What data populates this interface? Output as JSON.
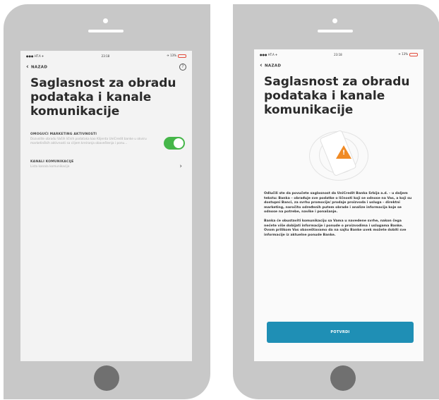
{
  "status_bar": {
    "carrier": "●●● HT.A ✈",
    "time": "23:18",
    "battery": "✈ 13%"
  },
  "left_screen": {
    "back_label": "NAZAD",
    "help_glyph": "?",
    "title": "Saglasnost za obradu podataka i kanale komunikacije",
    "marketing": {
      "title": "OMOGUĆI MARKETING AKTIVNOSTI",
      "description": "Dozvolite obradu Vaših ličnih podataka kao Klijenta UniCredit banke u okviru marketinških aktivnosti sa ciljem kreiranja obaveštenja i ponu...",
      "enabled": true
    },
    "channels": {
      "title": "KANALI KOMUNIKACIJE",
      "description": "Lista kanala komunikacije"
    }
  },
  "right_screen": {
    "back_label": "NAZAD",
    "title": "Saglasnost za obradu podataka i kanale komunikacije",
    "paragraph_1": "Odlučili ste da povučete saglasnost da UniCredit Banka Srbija a.d. – u daljem tekstu: Banka – obrađuje sve podatke o ličnosti koji se odnose na Vas, a koji su dostupni Banci, za svrhu promocije/ prodaje proizvoda i usluga – direktni marketing, naročito određenih putem obrade i analize informacija koje se odnose na potrebe, navike i ponašanje.",
    "paragraph_2": "Banka će obustaviti komunikaciju sa Vama u navedene svrhe, nakon čega nećete više dobijati informacije i ponude o proizvodima i uslugama Banke. Ovom prilikom Vas obaveštavamo da na sajtu Banke uvek možete dobiti sve informacije iz aktuelne ponude Banke.",
    "confirm_label": "POTVRDI"
  },
  "colors": {
    "toggle_on": "#45b649",
    "confirm_button": "#1f8fb5",
    "warning": "#f08a24",
    "phone_body": "#c8c8c8"
  }
}
